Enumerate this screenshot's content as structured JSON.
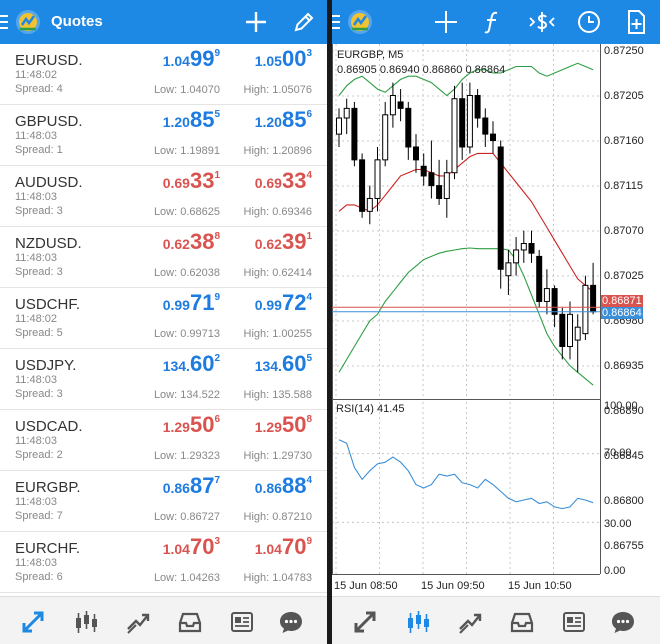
{
  "quotes_screen": {
    "title": "Quotes",
    "rows": [
      {
        "symbol": "EURUSD.",
        "time": "11:48:02",
        "spread": "Spread: 4",
        "dir": "up",
        "bid": {
          "small": "1.04",
          "big": "99",
          "pip": "9"
        },
        "ask": {
          "small": "1.05",
          "big": "00",
          "pip": "3"
        },
        "low": "Low: 1.04070",
        "high": "High: 1.05076"
      },
      {
        "symbol": "GBPUSD.",
        "time": "11:48:03",
        "spread": "Spread: 1",
        "dir": "up",
        "bid": {
          "small": "1.20",
          "big": "85",
          "pip": "5"
        },
        "ask": {
          "small": "1.20",
          "big": "85",
          "pip": "6"
        },
        "low": "Low: 1.19891",
        "high": "High: 1.20896"
      },
      {
        "symbol": "AUDUSD.",
        "time": "11:48:03",
        "spread": "Spread: 3",
        "dir": "dn",
        "bid": {
          "small": "0.69",
          "big": "33",
          "pip": "1"
        },
        "ask": {
          "small": "0.69",
          "big": "33",
          "pip": "4"
        },
        "low": "Low: 0.68625",
        "high": "High: 0.69346"
      },
      {
        "symbol": "NZDUSD.",
        "time": "11:48:03",
        "spread": "Spread: 3",
        "dir": "dn",
        "bid": {
          "small": "0.62",
          "big": "38",
          "pip": "8"
        },
        "ask": {
          "small": "0.62",
          "big": "39",
          "pip": "1"
        },
        "low": "Low: 0.62038",
        "high": "High: 0.62414"
      },
      {
        "symbol": "USDCHF.",
        "time": "11:48:02",
        "spread": "Spread: 5",
        "dir": "up",
        "bid": {
          "small": "0.99",
          "big": "71",
          "pip": "9"
        },
        "ask": {
          "small": "0.99",
          "big": "72",
          "pip": "4"
        },
        "low": "Low: 0.99713",
        "high": "High: 1.00255"
      },
      {
        "symbol": "USDJPY.",
        "time": "11:48:03",
        "spread": "Spread: 3",
        "dir": "up",
        "bid": {
          "small": "134.",
          "big": "60",
          "pip": "2"
        },
        "ask": {
          "small": "134.",
          "big": "60",
          "pip": "5"
        },
        "low": "Low: 134.522",
        "high": "High: 135.588"
      },
      {
        "symbol": "USDCAD.",
        "time": "11:48:03",
        "spread": "Spread: 2",
        "dir": "dn",
        "bid": {
          "small": "1.29",
          "big": "50",
          "pip": "6"
        },
        "ask": {
          "small": "1.29",
          "big": "50",
          "pip": "8"
        },
        "low": "Low: 1.29323",
        "high": "High: 1.29730"
      },
      {
        "symbol": "EURGBP.",
        "time": "11:48:03",
        "spread": "Spread: 7",
        "dir": "up",
        "bid": {
          "small": "0.86",
          "big": "87",
          "pip": "7"
        },
        "ask": {
          "small": "0.86",
          "big": "88",
          "pip": "4"
        },
        "low": "Low: 0.86727",
        "high": "High: 0.87210"
      },
      {
        "symbol": "EURCHF.",
        "time": "11:48:03",
        "spread": "Spread: 6",
        "dir": "dn",
        "bid": {
          "small": "1.04",
          "big": "70",
          "pip": "3"
        },
        "ask": {
          "small": "1.04",
          "big": "70",
          "pip": "9"
        },
        "low": "Low: 1.04263",
        "high": "High: 1.04783"
      }
    ]
  },
  "chart_screen": {
    "symbol_label": "EURGBP, M5",
    "ohlc_label": "0.86905 0.86940 0.86860 0.86864",
    "price_axis": [
      "0.87250",
      "0.87205",
      "0.87160",
      "0.87115",
      "0.87070",
      "0.87025",
      "0.86980",
      "0.86935",
      "0.86890",
      "0.86845",
      "0.86800",
      "0.86755"
    ],
    "bid_tag": "0.86864",
    "ask_tag": "0.86871",
    "rsi_label": "RSI(14) 41.45",
    "rsi_axis": [
      "100.00",
      "70.00",
      "30.00",
      "0.00"
    ],
    "time_axis": [
      "15 Jun 08:50",
      "15 Jun 09:50",
      "15 Jun 10:50"
    ]
  },
  "colors": {
    "accent": "#1e88e5",
    "price_up": "#1e7be0",
    "price_down": "#d9534f",
    "bollinger": "#2e9e44",
    "moving_average": "#cc2222",
    "rsi_line": "#3a8fd8",
    "bid_line": "#d9534f",
    "ask_line": "#3a8fd8"
  },
  "chart_data": [
    {
      "type": "candlestick",
      "title": "EURGBP, M5",
      "x_label_ticks": [
        "15 Jun 08:50",
        "15 Jun 09:50",
        "15 Jun 10:50"
      ],
      "ylim": [
        0.8673,
        0.8728
      ],
      "grid": true,
      "candles": [
        [
          0.8714,
          0.8718,
          0.8712,
          0.87165
        ],
        [
          0.87165,
          0.87195,
          0.8714,
          0.8718
        ],
        [
          0.8718,
          0.8719,
          0.8709,
          0.871
        ],
        [
          0.871,
          0.8711,
          0.8701,
          0.8702
        ],
        [
          0.8702,
          0.8706,
          0.87,
          0.8704
        ],
        [
          0.8704,
          0.8712,
          0.8702,
          0.871
        ],
        [
          0.871,
          0.8719,
          0.8709,
          0.8717
        ],
        [
          0.8717,
          0.8722,
          0.8715,
          0.872
        ],
        [
          0.8719,
          0.8721,
          0.8716,
          0.8718
        ],
        [
          0.8718,
          0.8719,
          0.871,
          0.8712
        ],
        [
          0.8712,
          0.8714,
          0.8708,
          0.871
        ],
        [
          0.8709,
          0.8711,
          0.8706,
          0.87075
        ],
        [
          0.8708,
          0.8713,
          0.8704,
          0.8706
        ],
        [
          0.8706,
          0.871,
          0.8703,
          0.8704
        ],
        [
          0.8704,
          0.871,
          0.8701,
          0.8708
        ],
        [
          0.8708,
          0.87215,
          0.8707,
          0.87195
        ],
        [
          0.87195,
          0.8722,
          0.871,
          0.8712
        ],
        [
          0.8712,
          0.8722,
          0.8711,
          0.872
        ],
        [
          0.872,
          0.8721,
          0.8715,
          0.87165
        ],
        [
          0.87165,
          0.8718,
          0.8712,
          0.8714
        ],
        [
          0.8714,
          0.8716,
          0.8711,
          0.8713
        ],
        [
          0.8712,
          0.8713,
          0.869,
          0.8693
        ],
        [
          0.8692,
          0.8696,
          0.8689,
          0.8694
        ],
        [
          0.8694,
          0.8698,
          0.8692,
          0.8696
        ],
        [
          0.8696,
          0.8699,
          0.8694,
          0.8697
        ],
        [
          0.8697,
          0.8699,
          0.8694,
          0.86955
        ],
        [
          0.8695,
          0.8696,
          0.8687,
          0.8688
        ],
        [
          0.8688,
          0.8693,
          0.8686,
          0.869
        ],
        [
          0.869,
          0.86905,
          0.8684,
          0.8686
        ],
        [
          0.8686,
          0.8687,
          0.8679,
          0.8681
        ],
        [
          0.8681,
          0.8688,
          0.8679,
          0.8686
        ],
        [
          0.8682,
          0.8686,
          0.8677,
          0.8684
        ],
        [
          0.8683,
          0.8692,
          0.8682,
          0.86905
        ],
        [
          0.86905,
          0.8694,
          0.8686,
          0.86864
        ]
      ],
      "series": [
        {
          "values": [
            0.8702,
            0.8703,
            0.8703,
            0.87025,
            0.8702,
            0.8703,
            0.87045,
            0.8706,
            0.87075,
            0.8708,
            0.87085,
            0.87085,
            0.8708,
            0.87075,
            0.87075,
            0.87085,
            0.87095,
            0.87105,
            0.8711,
            0.8711,
            0.8711,
            0.87095,
            0.8708,
            0.87065,
            0.8705,
            0.87035,
            0.87015,
            0.86995,
            0.86975,
            0.86955,
            0.86935,
            0.86915,
            0.86905,
            0.86895
          ]
        },
        {
          "values": [
            0.872,
            0.87215,
            0.87225,
            0.8723,
            0.8722,
            0.8721,
            0.87205,
            0.87215,
            0.87225,
            0.8723,
            0.8723,
            0.87225,
            0.8722,
            0.8721,
            0.872,
            0.8721,
            0.87225,
            0.87235,
            0.8724,
            0.8724,
            0.87235,
            0.87235,
            0.8724,
            0.87245,
            0.87245,
            0.87245,
            0.87235,
            0.8723,
            0.87235,
            0.8724,
            0.87245,
            0.8725,
            0.87245,
            0.8724
          ]
        },
        {
          "values": [
            0.8677,
            0.8679,
            0.8681,
            0.8683,
            0.8685,
            0.8686,
            0.8688,
            0.86895,
            0.8691,
            0.86925,
            0.86935,
            0.86945,
            0.8695,
            0.86955,
            0.86958,
            0.8696,
            0.86962,
            0.86963,
            0.86962,
            0.86962,
            0.86962,
            0.86962,
            0.8696,
            0.86945,
            0.8692,
            0.8689,
            0.8686,
            0.8683,
            0.8681,
            0.86795,
            0.8678,
            0.8677,
            0.8676,
            0.8675
          ]
        }
      ]
    },
    {
      "type": "line",
      "title": "RSI(14) 41.45",
      "ylim": [
        0,
        100
      ],
      "y_ticks": [
        100,
        70,
        30,
        0
      ],
      "series": [
        {
          "name": "RSI(14)",
          "values": [
            78,
            76,
            62,
            55,
            60,
            64,
            65,
            68,
            65,
            60,
            52,
            50,
            52,
            58,
            57,
            58,
            53,
            52,
            50,
            55,
            52,
            48,
            44,
            42,
            43,
            44,
            41,
            42,
            39,
            38,
            39,
            44,
            43,
            41.45
          ]
        }
      ]
    }
  ]
}
